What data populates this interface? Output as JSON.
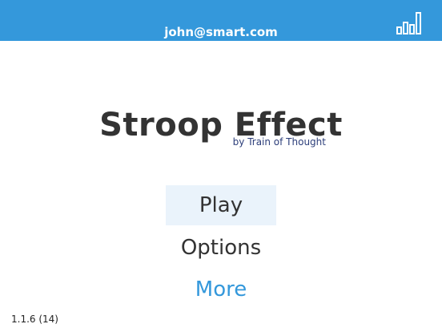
{
  "header": {
    "user_email": "john@smart.com",
    "stats_icon": "bar-chart-icon",
    "bar_color": "#3498db"
  },
  "title": {
    "name": "Stroop Effect",
    "subtitle": "by Train of Thought"
  },
  "menu": {
    "play_label": "Play",
    "options_label": "Options",
    "more_label": "More",
    "accent_color": "#3498db"
  },
  "footer": {
    "version": "1.1.6 (14)"
  }
}
